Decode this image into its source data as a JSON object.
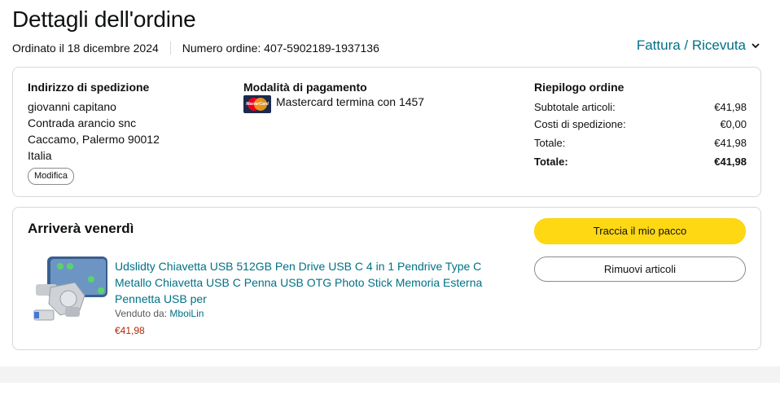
{
  "page": {
    "title": "Dettagli dell'ordine",
    "order_date": "Ordinato il 18 dicembre 2024",
    "order_number": "Numero ordine: 407-5902189-1937136",
    "invoice_link": "Fattura / Ricevuta"
  },
  "shipping": {
    "heading": "Indirizzo di spedizione",
    "name": "giovanni capitano",
    "street": "Contrada arancio snc",
    "city": "Caccamo, Palermo 90012",
    "country": "Italia",
    "edit_button": "Modifica"
  },
  "payment": {
    "heading": "Modalità di pagamento",
    "card_icon": "mastercard-icon",
    "card_logo_text": "MasterCard",
    "card_text": "Mastercard termina con 1457"
  },
  "summary": {
    "heading": "Riepilogo ordine",
    "rows": [
      {
        "label": "Subtotale articoli:",
        "value": "€41,98"
      },
      {
        "label": "Costi di spedizione:",
        "value": "€0,00"
      },
      {
        "label": "Totale:",
        "value": "€41,98"
      },
      {
        "label": "Totale:",
        "value": "€41,98"
      }
    ]
  },
  "shipment": {
    "arrival": "Arriverà venerdì",
    "track_button": "Traccia il mio pacco",
    "remove_button": "Rimuovi articoli",
    "product": {
      "title": "Udslidty Chiavetta USB 512GB Pen Drive USB C 4 in 1 Pendrive Type C Metallo Chiavetta USB C Penna USB OTG Photo Stick Memoria Esterna Pennetta USB per",
      "seller_label": "Venduto da:",
      "seller_name": "MboiLin",
      "price": "€41,98"
    }
  },
  "colors": {
    "link": "#007185",
    "track_button": "#ffd814",
    "price": "#b12704"
  }
}
